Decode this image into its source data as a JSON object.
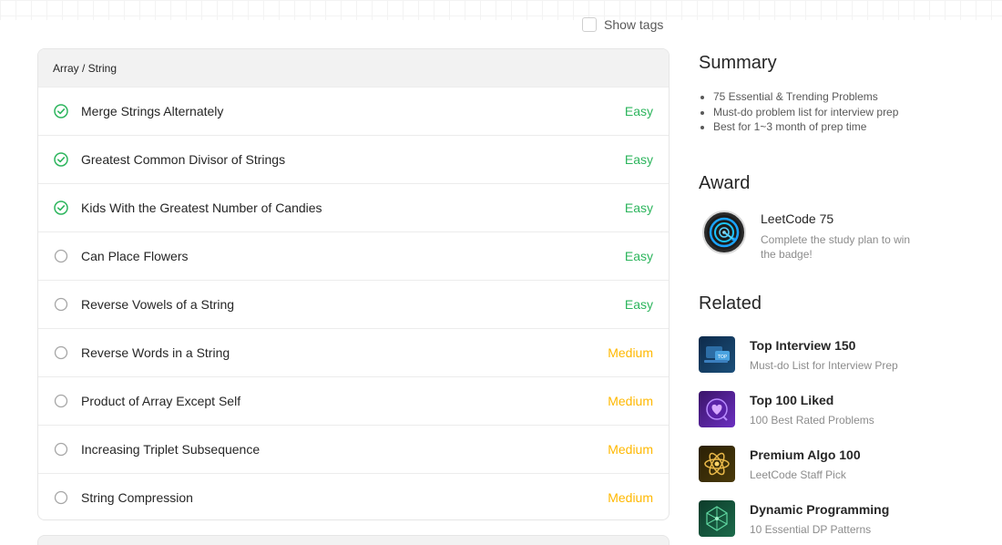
{
  "show_tags": {
    "label": "Show tags",
    "checked": false
  },
  "list": {
    "category": "Array / String",
    "problems": [
      {
        "title": "Merge Strings Alternately",
        "difficulty": "Easy",
        "solved": true
      },
      {
        "title": "Greatest Common Divisor of Strings",
        "difficulty": "Easy",
        "solved": true
      },
      {
        "title": "Kids With the Greatest Number of Candies",
        "difficulty": "Easy",
        "solved": true
      },
      {
        "title": "Can Place Flowers",
        "difficulty": "Easy",
        "solved": false
      },
      {
        "title": "Reverse Vowels of a String",
        "difficulty": "Easy",
        "solved": false
      },
      {
        "title": "Reverse Words in a String",
        "difficulty": "Medium",
        "solved": false
      },
      {
        "title": "Product of Array Except Self",
        "difficulty": "Medium",
        "solved": false
      },
      {
        "title": "Increasing Triplet Subsequence",
        "difficulty": "Medium",
        "solved": false
      },
      {
        "title": "String Compression",
        "difficulty": "Medium",
        "solved": false
      }
    ]
  },
  "summary": {
    "title": "Summary",
    "items": [
      "75 Essential & Trending Problems",
      "Must-do problem list for interview prep",
      "Best for 1~3 month of prep time"
    ]
  },
  "award": {
    "title": "Award",
    "name": "LeetCode 75",
    "description": "Complete the study plan to win the badge!"
  },
  "related": {
    "title": "Related",
    "items": [
      {
        "name": "Top Interview 150",
        "sub": "Must-do List for Interview Prep",
        "icon": "top-interview-thumb-icon"
      },
      {
        "name": "Top 100 Liked",
        "sub": "100 Best Rated Problems",
        "icon": "heart-thumb-icon"
      },
      {
        "name": "Premium Algo 100",
        "sub": "LeetCode Staff Pick",
        "icon": "atom-thumb-icon"
      },
      {
        "name": "Dynamic Programming",
        "sub": "10 Essential DP Patterns",
        "icon": "network-thumb-icon"
      }
    ]
  },
  "colors": {
    "easy": "#2db55d",
    "medium": "#ffb800",
    "solved_check": "#2db55d"
  }
}
